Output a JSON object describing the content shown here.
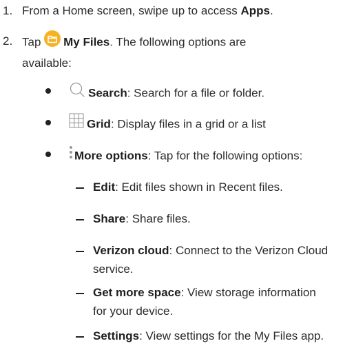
{
  "steps": [
    {
      "number": "1.",
      "pre": "From a Home screen, swipe up to access ",
      "bold": "Apps",
      "post": "."
    },
    {
      "number": "2.",
      "pre": "Tap ",
      "icon": "my-files-folder-icon",
      "bold": "My Files",
      "post_line1": ". The following options are",
      "post_line2": "available:"
    }
  ],
  "options": [
    {
      "icon": "search-icon",
      "label": "Search",
      "desc": ": Search for a file or folder."
    },
    {
      "icon": "grid-icon",
      "label": "Grid",
      "desc": ": Display files in a grid or a list"
    },
    {
      "icon": "more-options-icon",
      "label": "More options",
      "desc": ": Tap for the following options:"
    }
  ],
  "more_options": [
    {
      "label": "Edit",
      "desc": ": Edit files shown in Recent files."
    },
    {
      "label": "Share",
      "desc": ": Share files."
    },
    {
      "label": "Verizon cloud",
      "desc": ": Connect to the Verizon Cloud",
      "desc2": "service."
    },
    {
      "label": "Get more space",
      "desc": ": View storage information",
      "desc2": "for your device."
    },
    {
      "label": "Settings",
      "desc": ": View settings for the My Files app."
    }
  ],
  "colors": {
    "folder_icon": "#f5b324",
    "text": "#2a2a2a",
    "icon_gray": "#9a9a9a"
  }
}
